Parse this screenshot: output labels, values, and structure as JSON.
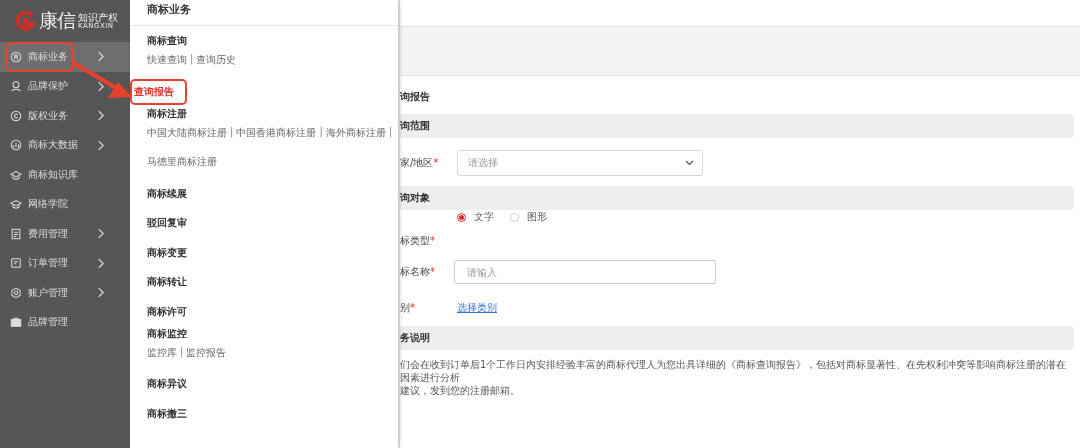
{
  "logo": {
    "name": "康信",
    "tagline": "知识产权",
    "latin": "KANGXIN"
  },
  "sidebar": {
    "items": [
      {
        "label": "商标业务",
        "has_children": true,
        "selected": true,
        "highlighted": true
      },
      {
        "label": "品牌保护",
        "has_children": true,
        "selected": false,
        "highlighted": false
      },
      {
        "label": "版权业务",
        "has_children": true,
        "selected": false,
        "highlighted": false
      },
      {
        "label": "商标大数据",
        "has_children": true,
        "selected": false,
        "highlighted": false
      },
      {
        "label": "商标知识库",
        "has_children": false,
        "selected": false,
        "highlighted": false
      },
      {
        "label": "网络学院",
        "has_children": false,
        "selected": false,
        "highlighted": false
      },
      {
        "label": "费用管理",
        "has_children": true,
        "selected": false,
        "highlighted": false
      },
      {
        "label": "订单管理",
        "has_children": true,
        "selected": false,
        "highlighted": false
      },
      {
        "label": "账户管理",
        "has_children": true,
        "selected": false,
        "highlighted": false
      },
      {
        "label": "品牌管理",
        "has_children": false,
        "selected": false,
        "highlighted": false
      }
    ]
  },
  "flyout": {
    "title": "商标业务",
    "entries": [
      {
        "kind": "group",
        "label": "商标查询",
        "rows": [
          [
            {
              "label": "快速查询",
              "sep": "|"
            },
            {
              "label": "查询历史"
            }
          ]
        ]
      },
      {
        "kind": "link",
        "label": "查询报告",
        "selected": true,
        "highlighted": true
      },
      {
        "kind": "group",
        "label": "商标注册",
        "rows": [
          [
            {
              "label": "中国大陆商标注册",
              "sep": "|"
            },
            {
              "label": "中国香港商标注册",
              "sep": "|"
            },
            {
              "label": "海外商标注册",
              "sep": "|"
            }
          ],
          [
            {
              "label": "马德里商标注册"
            }
          ]
        ]
      },
      {
        "kind": "link",
        "label": "商标续展",
        "selected": false,
        "highlighted": false
      },
      {
        "kind": "link",
        "label": "驳回复审",
        "selected": false,
        "highlighted": false
      },
      {
        "kind": "link",
        "label": "商标变更",
        "selected": false,
        "highlighted": false
      },
      {
        "kind": "link",
        "label": "商标转让",
        "selected": false,
        "highlighted": false
      },
      {
        "kind": "link",
        "label": "商标许可",
        "selected": false,
        "highlighted": false
      },
      {
        "kind": "group",
        "label": "商标监控",
        "rows": [
          [
            {
              "label": "监控库",
              "sep": "|"
            },
            {
              "label": "监控报告"
            }
          ]
        ]
      },
      {
        "kind": "link",
        "label": "商标异议",
        "selected": false,
        "highlighted": false
      },
      {
        "kind": "link",
        "label": "商标撤三",
        "selected": false,
        "highlighted": false
      }
    ]
  },
  "form": {
    "heading": "询报告",
    "sections": [
      {
        "title": "询范围",
        "fields": [
          {
            "kind": "select",
            "label": "家/地区",
            "required_mark": "*",
            "placeholder": "请选择"
          }
        ]
      },
      {
        "title": "询对象",
        "fields": [
          {
            "kind": "radio",
            "label": "标类型",
            "required_mark": "*",
            "options": [
              {
                "label": "文字",
                "selected": true
              },
              {
                "label": "图形",
                "selected": false
              }
            ]
          },
          {
            "kind": "input",
            "label": "标名称",
            "required_mark": "*",
            "placeholder": "请输入"
          },
          {
            "kind": "link",
            "label": "别",
            "required_mark": "*",
            "link": "选择类别"
          }
        ]
      },
      {
        "title": "务说明",
        "paragraph": [
          "们会在收到订单后1个工作日内安排经验丰富的商标代理人为您出具详细的《商标查询报告》，包括对商标显著性、在先权利冲突等影响商标注册的潜在因素进行分析",
          "建议，发到您的注册邮箱。"
        ]
      }
    ]
  }
}
